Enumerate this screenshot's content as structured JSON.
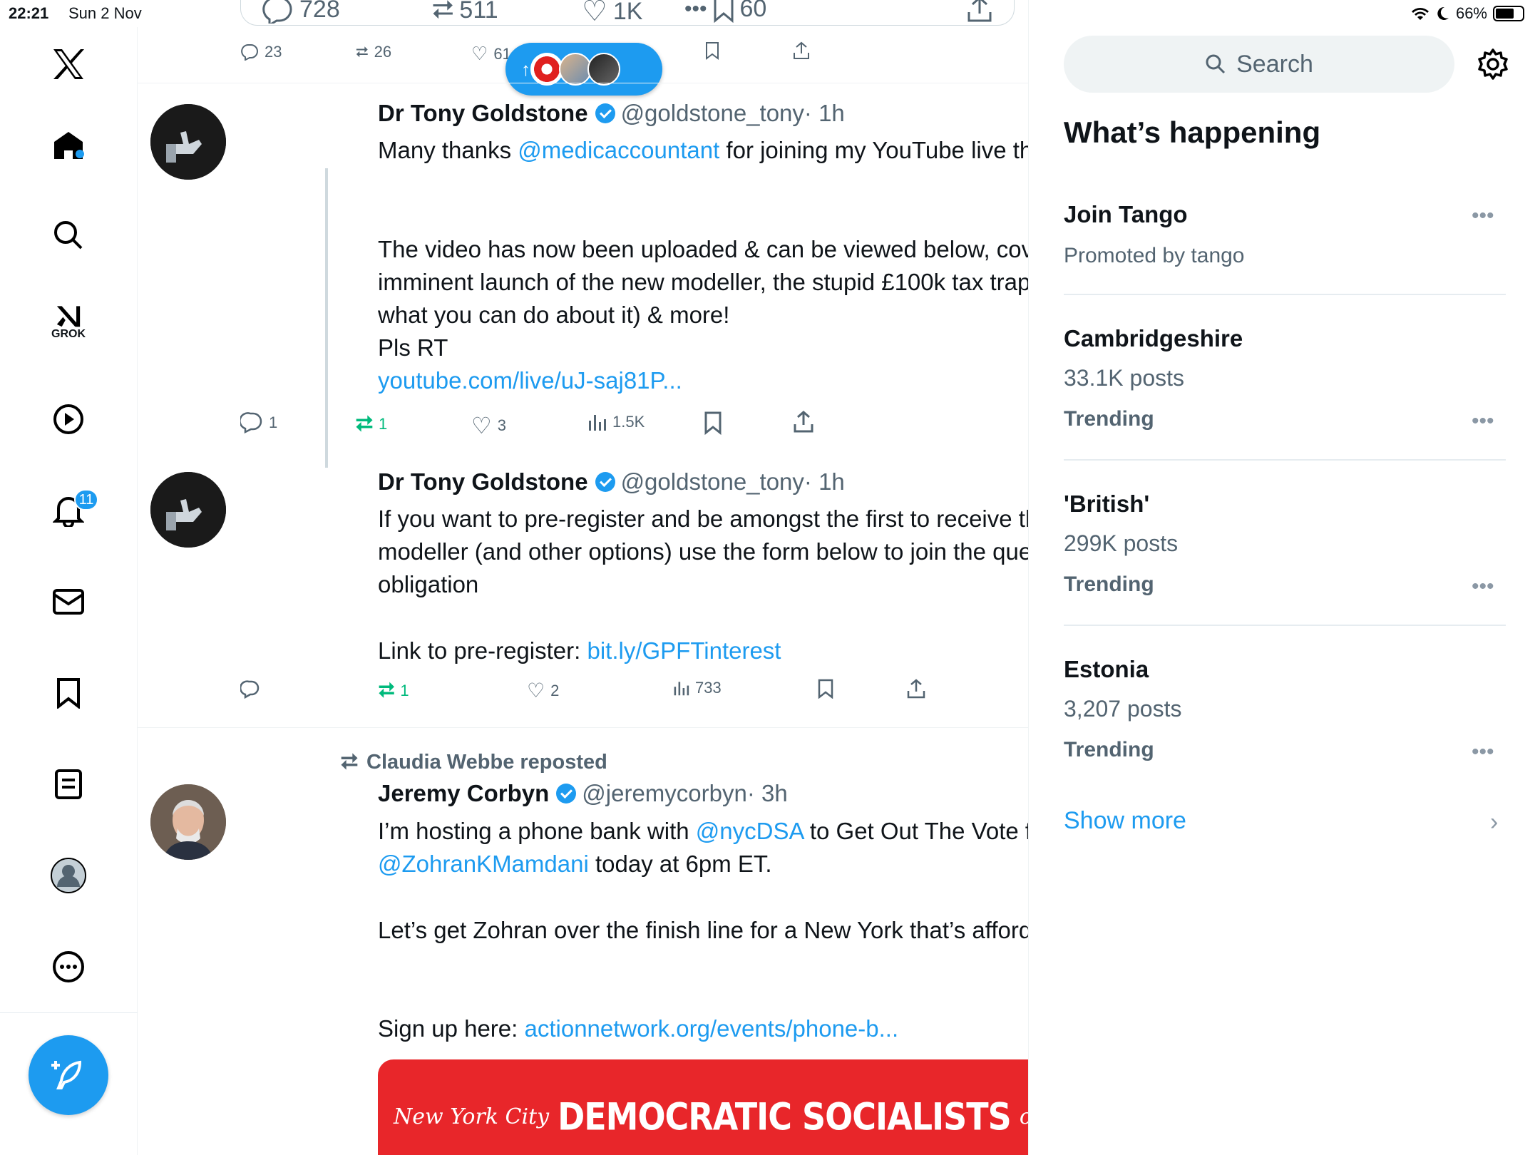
{
  "status_bar": {
    "time": "22:21",
    "date": "Sun 2 Nov",
    "battery": "66%"
  },
  "nav": {
    "notifications_badge": "11",
    "grok_label": "GROK"
  },
  "top_card": {
    "replies": "728",
    "reposts": "511",
    "likes": "1K",
    "bookmarks": "60"
  },
  "top_actions": {
    "replies": "23",
    "reposts": "26",
    "likes": "61"
  },
  "tweets": [
    {
      "name": "Dr Tony Goldstone",
      "handle": "@goldstone_tony",
      "time": "· 1h",
      "text_pre": "Many thanks ",
      "mention1": "@medicaccountant",
      "text_post": " for joining my YouTube live this evening",
      "para2": "The video has now been uploaded & can be viewed below, covering the imminent launch of the new modeller, the stupid £100k tax trap / taper (& what you can do about it) & more!",
      "para3": "Pls RT",
      "link": "youtube.com/live/uJ-saj81P...",
      "replies": "1",
      "reposts": "1",
      "likes": "3",
      "views": "1.5K"
    },
    {
      "name": "Dr Tony Goldstone",
      "handle": "@goldstone_tony",
      "time": "· 1h",
      "para1": "If you want to pre-register and be amongst the first to receive the free modeller (and other options) use the form below to join the queue without obligation",
      "link_label": "Link to pre-register: ",
      "link": "bit.ly/GPFTinterest",
      "reposts": "1",
      "likes": "2",
      "views": "733"
    },
    {
      "repost_by": "Claudia Webbe reposted",
      "name": "Jeremy Corbyn",
      "handle": "@jeremycorbyn",
      "time": "· 3h",
      "text_pre": "I’m hosting a phone bank with ",
      "mention1": "@nycDSA",
      "text_mid": " to Get Out The Vote for",
      "mention2": "@ZohranKMamdani",
      "text_post": " today at 6pm ET.",
      "para2": "Let’s get Zohran over the finish line for a New York that’s affordable for all!",
      "link_label": "Sign up here: ",
      "link": "actionnetwork.org/events/phone-b...",
      "card_small1": "New York City",
      "card_big": "DEMOCRATIC SOCIALISTS",
      "card_small2": "of America"
    }
  ],
  "sidebar": {
    "search_placeholder": "Search",
    "title": "What’s happening",
    "trends": [
      {
        "name": "Join Tango",
        "sub": "Promoted by tango"
      },
      {
        "name": "Cambridgeshire",
        "sub": "33.1K posts",
        "tag": "Trending"
      },
      {
        "name": "'British'",
        "sub": "299K posts",
        "tag": "Trending"
      },
      {
        "name": "Estonia",
        "sub": "3,207 posts",
        "tag": "Trending"
      }
    ],
    "show_more": "Show more"
  },
  "colors": {
    "accent": "#1d9bf0",
    "repost_green": "#00ba7c",
    "dsa_red": "#e8262a"
  }
}
